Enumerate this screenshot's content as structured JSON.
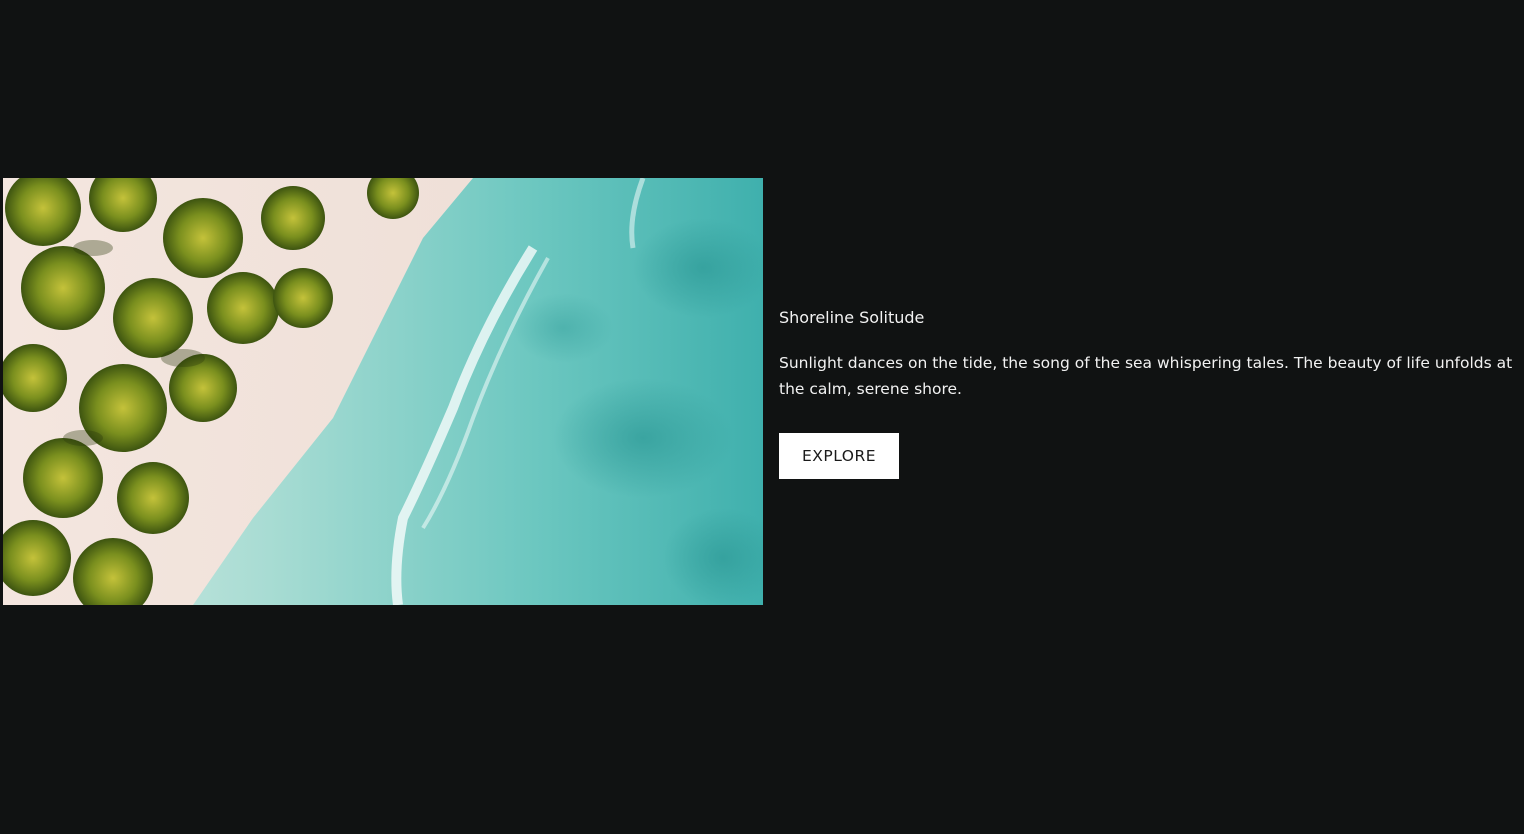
{
  "card": {
    "title": "Shoreline Solitude",
    "description": "Sunlight dances on the tide, the song of the sea whispering tales. The beauty of life unfolds at the calm, serene shore.",
    "button_label": "EXPLORE"
  },
  "colors": {
    "background": "#101212",
    "text": "#f2f2f2",
    "button_bg": "#ffffff",
    "button_text": "#1a1a1a"
  }
}
